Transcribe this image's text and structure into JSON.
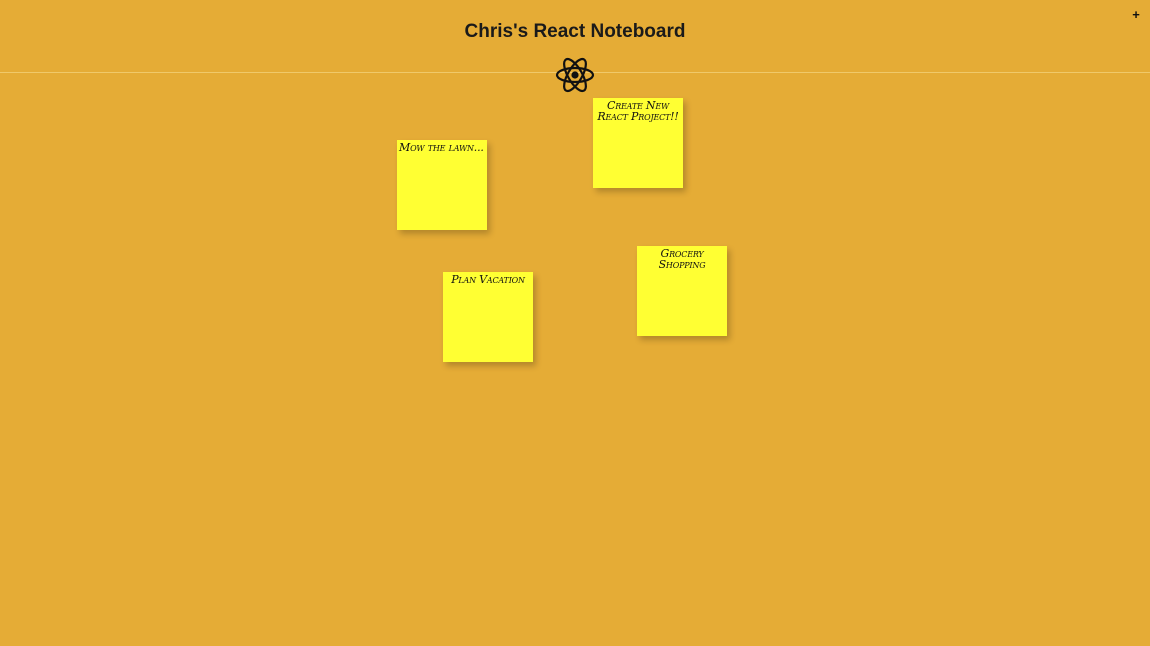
{
  "header": {
    "title": "Chris's React Noteboard",
    "add_label": "+",
    "logo_icon": "react-atom-icon"
  },
  "colors": {
    "background": "#e5ac36",
    "note": "#ffff33",
    "text": "#111111"
  },
  "notes": [
    {
      "text": "Mow the lawn..."
    },
    {
      "text": "Create New React Project!!"
    },
    {
      "text": "Plan Vacation"
    },
    {
      "text": "Grocery Shopping"
    }
  ]
}
